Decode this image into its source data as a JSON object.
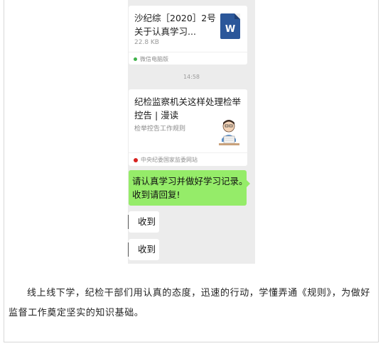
{
  "chat": {
    "file_card": {
      "title_line1": "沙纪综［2020］2号",
      "title_line2": "关于认真学习...",
      "size": "22.8 KB",
      "source": "微信电脑版",
      "file_type_letter": "W",
      "icon": "word-document-icon",
      "source_color": "#3fb14a"
    },
    "timestamp": "14:58",
    "article_card": {
      "title": "纪检监察机关这样处理检举控告 | 漫读",
      "description": "检举控告工作规则",
      "source": "中央纪委国家监委网站",
      "source_color": "#d7221f",
      "thumbnail": "cartoon-reader-thumbnail"
    },
    "sent_message": {
      "line1": "请认真学习并做好学习记录。",
      "line2": "收到请回复!"
    },
    "replies": [
      "收到",
      "收到"
    ]
  },
  "caption": {
    "text": "线上线下学，纪检干部们用认真的态度，迅速的行动，学懂弄通《规则》，为做好监督工作奠定坚实的知识基础。"
  },
  "colors": {
    "chat_background": "#ececec",
    "sent_bubble": "#95ec69",
    "word_blue": "#2b579a"
  }
}
